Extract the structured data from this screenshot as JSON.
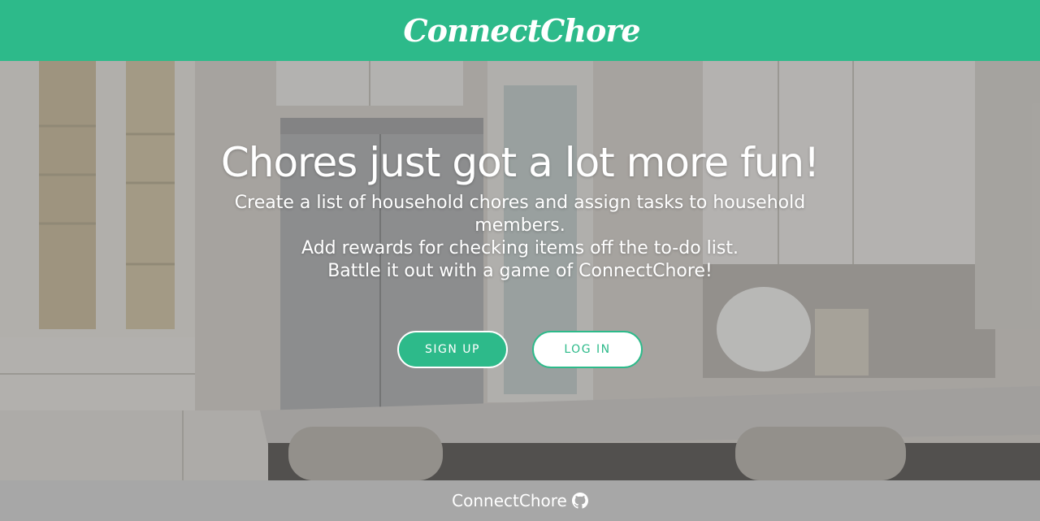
{
  "header": {
    "logo_text": "ConnectChore"
  },
  "hero": {
    "title": "Chores just got a lot more fun!",
    "lines": [
      "Create a list of household chores and assign tasks to household members.",
      "Add rewards for checking items off the to-do list.",
      "Battle it out with a game of ConnectChore!"
    ],
    "background_image": "kitchen-photo"
  },
  "buttons": {
    "signup_label": "SIGN UP",
    "login_label": "LOG IN"
  },
  "footer": {
    "text": "ConnectChore",
    "icon": "github-icon"
  },
  "colors": {
    "brand": "#2dba8a",
    "footer": "#a7a7a7",
    "white": "#ffffff"
  }
}
